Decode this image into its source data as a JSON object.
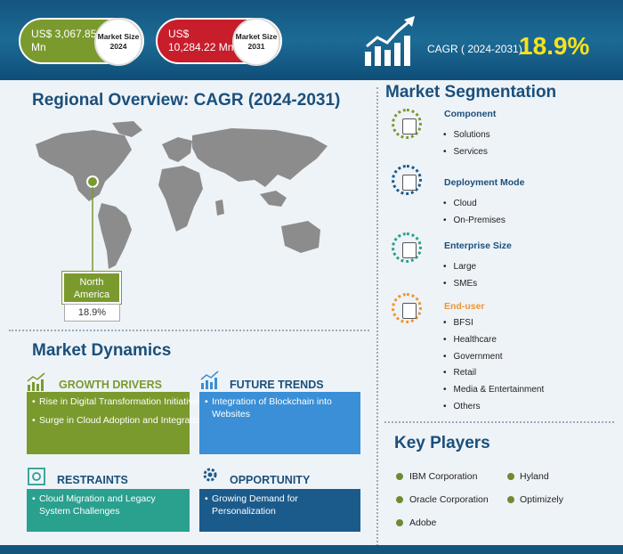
{
  "header": {
    "market_2024_value": "US$ 3,067.85 Mn",
    "market_2024_label": "Market Size 2024",
    "market_2031_value": "US$ 10,284.22 Mn",
    "market_2031_label": "Market Size 2031",
    "cagr_label": "CAGR ( 2024-2031)",
    "cagr_value": "18.9%"
  },
  "regional": {
    "title": "Regional Overview: CAGR (2024-2031)",
    "region": "North America",
    "region_cagr": "18.9%"
  },
  "dynamics": {
    "title": "Market Dynamics",
    "growth_drivers": {
      "title": "GROWTH DRIVERS",
      "items": [
        "Rise in Digital Transformation Initiatives",
        "Surge in Cloud Adoption and Integration"
      ]
    },
    "future_trends": {
      "title": "FUTURE TRENDS",
      "items": [
        "Integration of Blockchain into Websites"
      ]
    },
    "restraints": {
      "title": "RESTRAINTS",
      "items": [
        "Cloud Migration and Legacy System Challenges"
      ]
    },
    "opportunity": {
      "title": "OPPORTUNITY",
      "items": [
        "Growing Demand for Personalization"
      ]
    }
  },
  "segmentation": {
    "title": "Market Segmentation",
    "groups": [
      {
        "title": "Component",
        "items": [
          "Solutions",
          "Services"
        ]
      },
      {
        "title": "Deployment Mode",
        "items": [
          "Cloud",
          "On-Premises"
        ]
      },
      {
        "title": "Enterprise Size",
        "items": [
          "Large",
          "SMEs"
        ]
      },
      {
        "title": "End-user",
        "items": [
          "BFSI",
          "Healthcare",
          "Government",
          "Retail",
          "Media & Entertainment",
          "Others"
        ]
      }
    ]
  },
  "key_players": {
    "title": "Key Players",
    "items": [
      "IBM Corporation",
      "Hyland",
      "Oracle Corporation",
      "Optimizely",
      "Adobe"
    ]
  },
  "colors": {
    "green": "#7a9a2e",
    "red": "#c81d2b",
    "navy": "#13557f",
    "yellow": "#f7e21b",
    "blue": "#3a8fd6",
    "teal": "#2aa08f",
    "dark_blue": "#1b5b8c",
    "orange": "#f0962b"
  }
}
